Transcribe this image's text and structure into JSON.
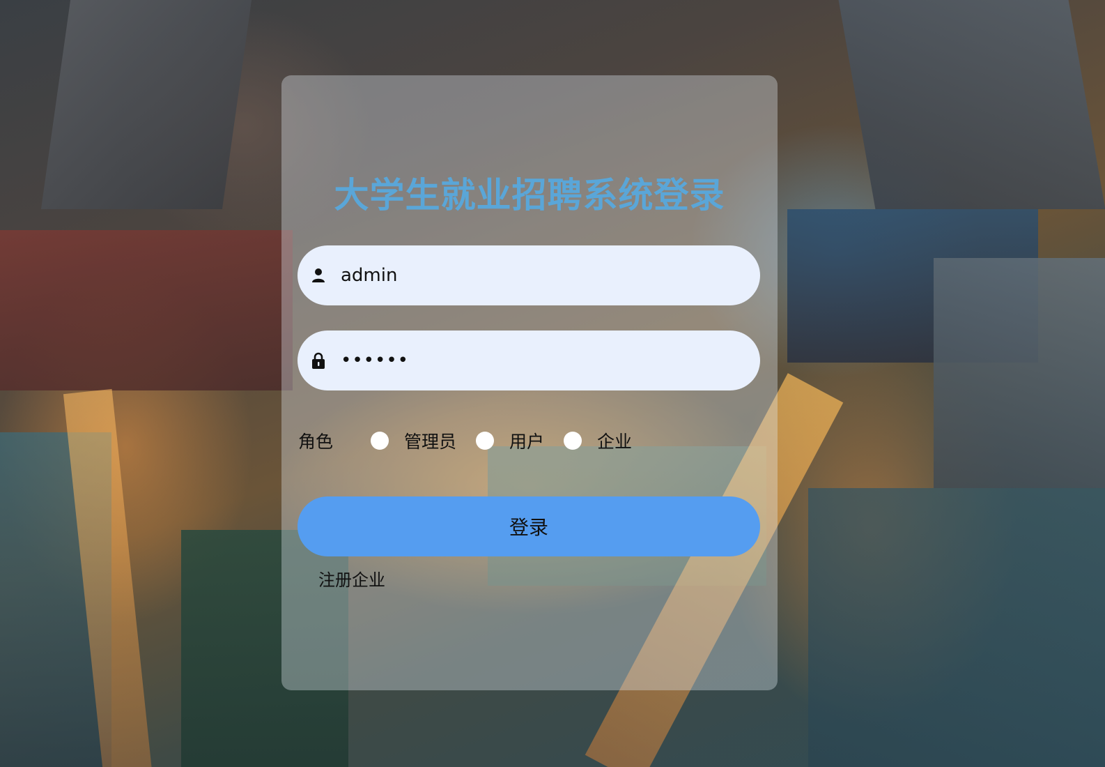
{
  "page": {
    "title": "大学生就业招聘系统登录"
  },
  "login_form": {
    "username_value": "admin",
    "password_value": "••••••",
    "role_label": "角色",
    "roles": [
      {
        "label": "管理员"
      },
      {
        "label": "用户"
      },
      {
        "label": "企业"
      }
    ],
    "submit_label": "登录",
    "register_label": "注册企业"
  },
  "icons": {
    "username": "user-icon",
    "password": "lock-icon"
  },
  "colors": {
    "title": "#5aa6d8",
    "button": "#559df0",
    "input_bg": "#e9f0fd"
  }
}
